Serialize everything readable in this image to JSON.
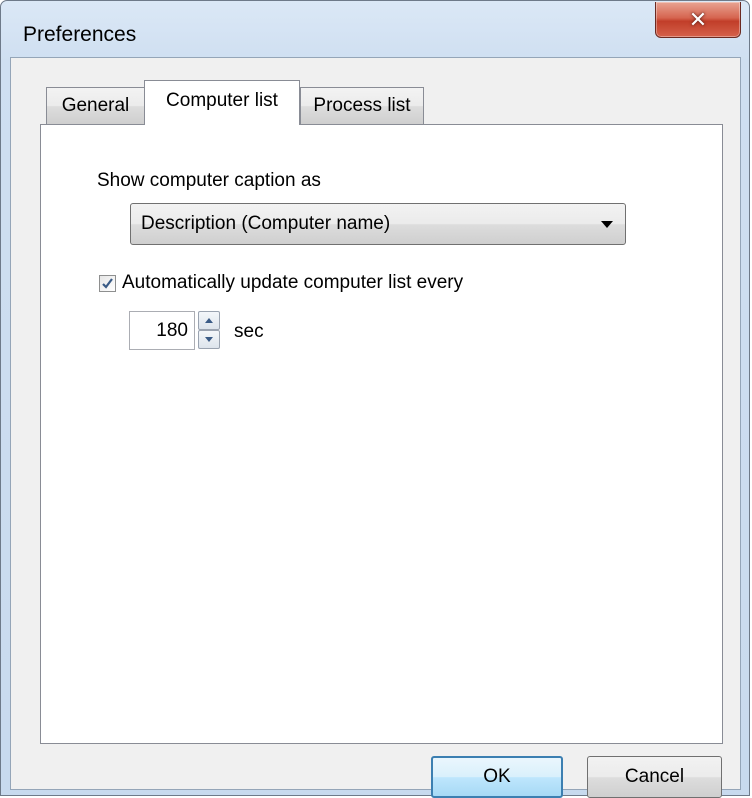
{
  "window": {
    "title": "Preferences"
  },
  "tabs": [
    {
      "label": "General",
      "active": false
    },
    {
      "label": "Computer list",
      "active": true
    },
    {
      "label": "Process list",
      "active": false
    }
  ],
  "computer_list": {
    "caption_label": "Show computer caption as",
    "caption_select": {
      "selected": "Description (Computer name)"
    },
    "auto_update": {
      "label": "Automatically update computer list every",
      "checked": true,
      "interval_value": "180",
      "interval_unit": "sec"
    }
  },
  "buttons": {
    "ok": "OK",
    "cancel": "Cancel"
  },
  "colors": {
    "titlebar": "#cfdff1",
    "close_button": "#c13e29",
    "default_button_border": "#3c7fb1",
    "checkmark": "#3a5b86"
  }
}
